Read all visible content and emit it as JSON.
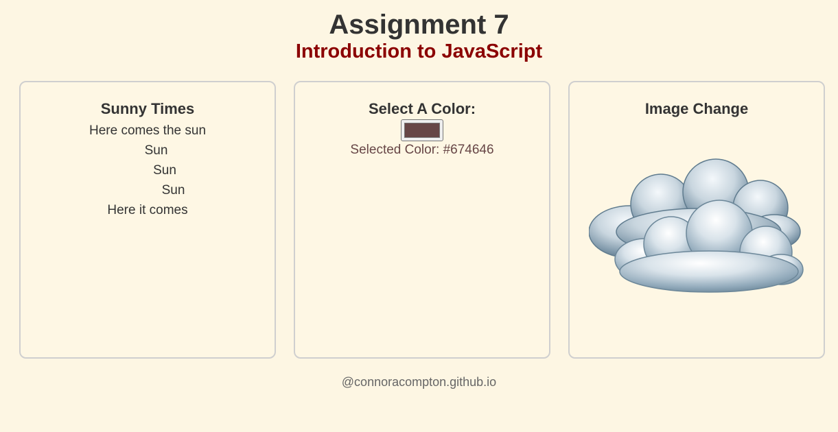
{
  "header": {
    "title": "Assignment 7",
    "subtitle": "Introduction to JavaScript"
  },
  "panels": {
    "sunny": {
      "heading": "Sunny Times",
      "lines": [
        "Here comes the sun",
        "Sun",
        "Sun",
        "Sun",
        "Here it comes"
      ]
    },
    "color": {
      "heading": "Select A Color:",
      "value": "#674646",
      "selected_text": "Selected Color: #674646"
    },
    "image": {
      "heading": "Image Change",
      "icon": "cloud-icon"
    }
  },
  "footer": {
    "text": "@connoracompton.github.io"
  },
  "colors": {
    "background": "#fdf6e3",
    "subtitle": "#8b0000",
    "border": "#cfcfcf",
    "selected": "#674646"
  }
}
